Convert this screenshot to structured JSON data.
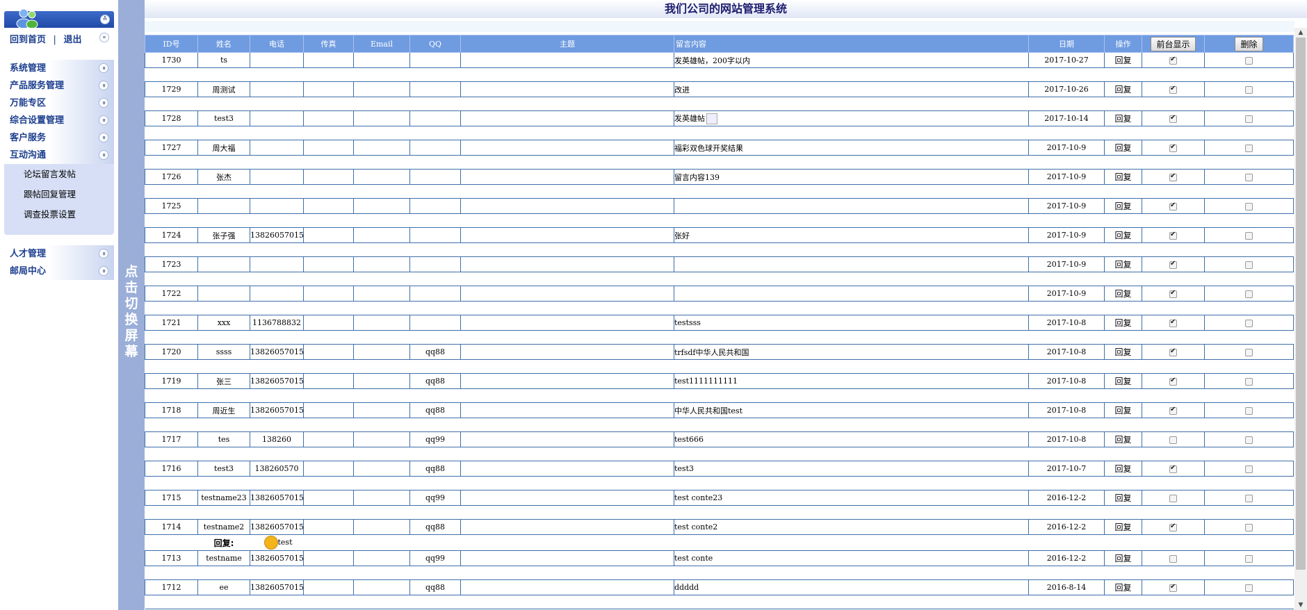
{
  "header": {
    "title": "我们公司的网站管理系统"
  },
  "sidebar": {
    "home_link": "回到首页",
    "separator": "|",
    "logout_link": "退出",
    "menu_group1": [
      {
        "label": "系统管理"
      },
      {
        "label": "产品服务管理"
      },
      {
        "label": "万能专区"
      },
      {
        "label": "综合设置管理"
      },
      {
        "label": "客户服务"
      },
      {
        "label": "互动沟通"
      }
    ],
    "submenu": [
      {
        "label": "论坛留言发帖"
      },
      {
        "label": "跟帖回复管理"
      },
      {
        "label": "调查投票设置"
      }
    ],
    "menu_group2": [
      {
        "label": "人才管理"
      },
      {
        "label": "邮局中心"
      }
    ]
  },
  "toggle": {
    "chars": [
      "点",
      "击",
      "切",
      "换",
      "屏",
      "幕"
    ]
  },
  "table": {
    "columns": [
      "ID号",
      "姓名",
      "电话",
      "传真",
      "Email",
      "QQ",
      "主题",
      "留言内容",
      "日期",
      "操作"
    ],
    "show_button": "前台显示",
    "delete_button": "删除",
    "reply_action": "回复",
    "rows": [
      {
        "id": "1730",
        "name": "ts",
        "phone": "",
        "fax": "",
        "email": "",
        "qq": "",
        "subject": "",
        "content": "发英雄帖，200字以内",
        "date": "2017-10-27",
        "shown": true
      },
      {
        "id": "1729",
        "name": "周测试",
        "phone": "",
        "fax": "",
        "email": "",
        "qq": "",
        "subject": "",
        "content": "改进",
        "date": "2017-10-26",
        "shown": true
      },
      {
        "id": "1728",
        "name": "test3",
        "phone": "",
        "fax": "",
        "email": "",
        "qq": "",
        "subject": "",
        "content": "发英雄帖",
        "date": "2017-10-14",
        "shown": true,
        "broken_img": true
      },
      {
        "id": "1727",
        "name": "周大福",
        "phone": "",
        "fax": "",
        "email": "",
        "qq": "",
        "subject": "",
        "content": "福彩双色球开奖结果",
        "date": "2017-10-9",
        "shown": true
      },
      {
        "id": "1726",
        "name": "张杰",
        "phone": "",
        "fax": "",
        "email": "",
        "qq": "",
        "subject": "",
        "content": "留言内容139",
        "date": "2017-10-9",
        "shown": true
      },
      {
        "id": "1725",
        "name": "",
        "phone": "",
        "fax": "",
        "email": "",
        "qq": "",
        "subject": "",
        "content": "",
        "date": "2017-10-9",
        "shown": true
      },
      {
        "id": "1724",
        "name": "张子强",
        "phone": "13826057015",
        "fax": "",
        "email": "",
        "qq": "",
        "subject": "",
        "content": "张好",
        "date": "2017-10-9",
        "shown": true
      },
      {
        "id": "1723",
        "name": "",
        "phone": "",
        "fax": "",
        "email": "",
        "qq": "",
        "subject": "",
        "content": "",
        "date": "2017-10-9",
        "shown": true
      },
      {
        "id": "1722",
        "name": "",
        "phone": "",
        "fax": "",
        "email": "",
        "qq": "",
        "subject": "",
        "content": "",
        "date": "2017-10-9",
        "shown": true
      },
      {
        "id": "1721",
        "name": "xxx",
        "phone": "1136788832",
        "fax": "",
        "email": "",
        "qq": "",
        "subject": "",
        "content": "testsss",
        "date": "2017-10-8",
        "shown": true
      },
      {
        "id": "1720",
        "name": "ssss",
        "phone": "13826057015",
        "fax": "",
        "email": "",
        "qq": "qq88",
        "subject": "",
        "content": "trfsdf中华人民共和国",
        "date": "2017-10-8",
        "shown": true
      },
      {
        "id": "1719",
        "name": "张三",
        "phone": "13826057015",
        "fax": "",
        "email": "",
        "qq": "qq88",
        "subject": "",
        "content": "test1111111111",
        "date": "2017-10-8",
        "shown": true
      },
      {
        "id": "1718",
        "name": "周近生",
        "phone": "13826057015",
        "fax": "",
        "email": "",
        "qq": "qq88",
        "subject": "",
        "content": "中华人民共和国test",
        "date": "2017-10-8",
        "shown": true
      },
      {
        "id": "1717",
        "name": "tes",
        "phone": "138260",
        "fax": "",
        "email": "",
        "qq": "qq99",
        "subject": "",
        "content": "test666",
        "date": "2017-10-8",
        "shown": false
      },
      {
        "id": "1716",
        "name": "test3",
        "phone": "138260570",
        "fax": "",
        "email": "",
        "qq": "qq88",
        "subject": "",
        "content": "test3",
        "date": "2017-10-7",
        "shown": true
      },
      {
        "id": "1715",
        "name": "testname23",
        "phone": "13826057015",
        "fax": "",
        "email": "",
        "qq": "qq99",
        "subject": "",
        "content": "test conte23",
        "date": "2016-12-2",
        "shown": false
      },
      {
        "id": "1714",
        "name": "testname2",
        "phone": "13826057015",
        "fax": "",
        "email": "",
        "qq": "qq88",
        "subject": "",
        "content": "test conte2",
        "date": "2016-12-2",
        "shown": true,
        "reply": {
          "label": "回复:",
          "text": "test"
        }
      },
      {
        "id": "1713",
        "name": "testname",
        "phone": "13826057015",
        "fax": "",
        "email": "",
        "qq": "qq99",
        "subject": "",
        "content": "test conte",
        "date": "2016-12-2",
        "shown": false
      },
      {
        "id": "1712",
        "name": "ee",
        "phone": "13826057015",
        "fax": "",
        "email": "",
        "qq": "qq88",
        "subject": "",
        "content": "ddddd",
        "date": "2016-8-14",
        "shown": true
      }
    ]
  }
}
